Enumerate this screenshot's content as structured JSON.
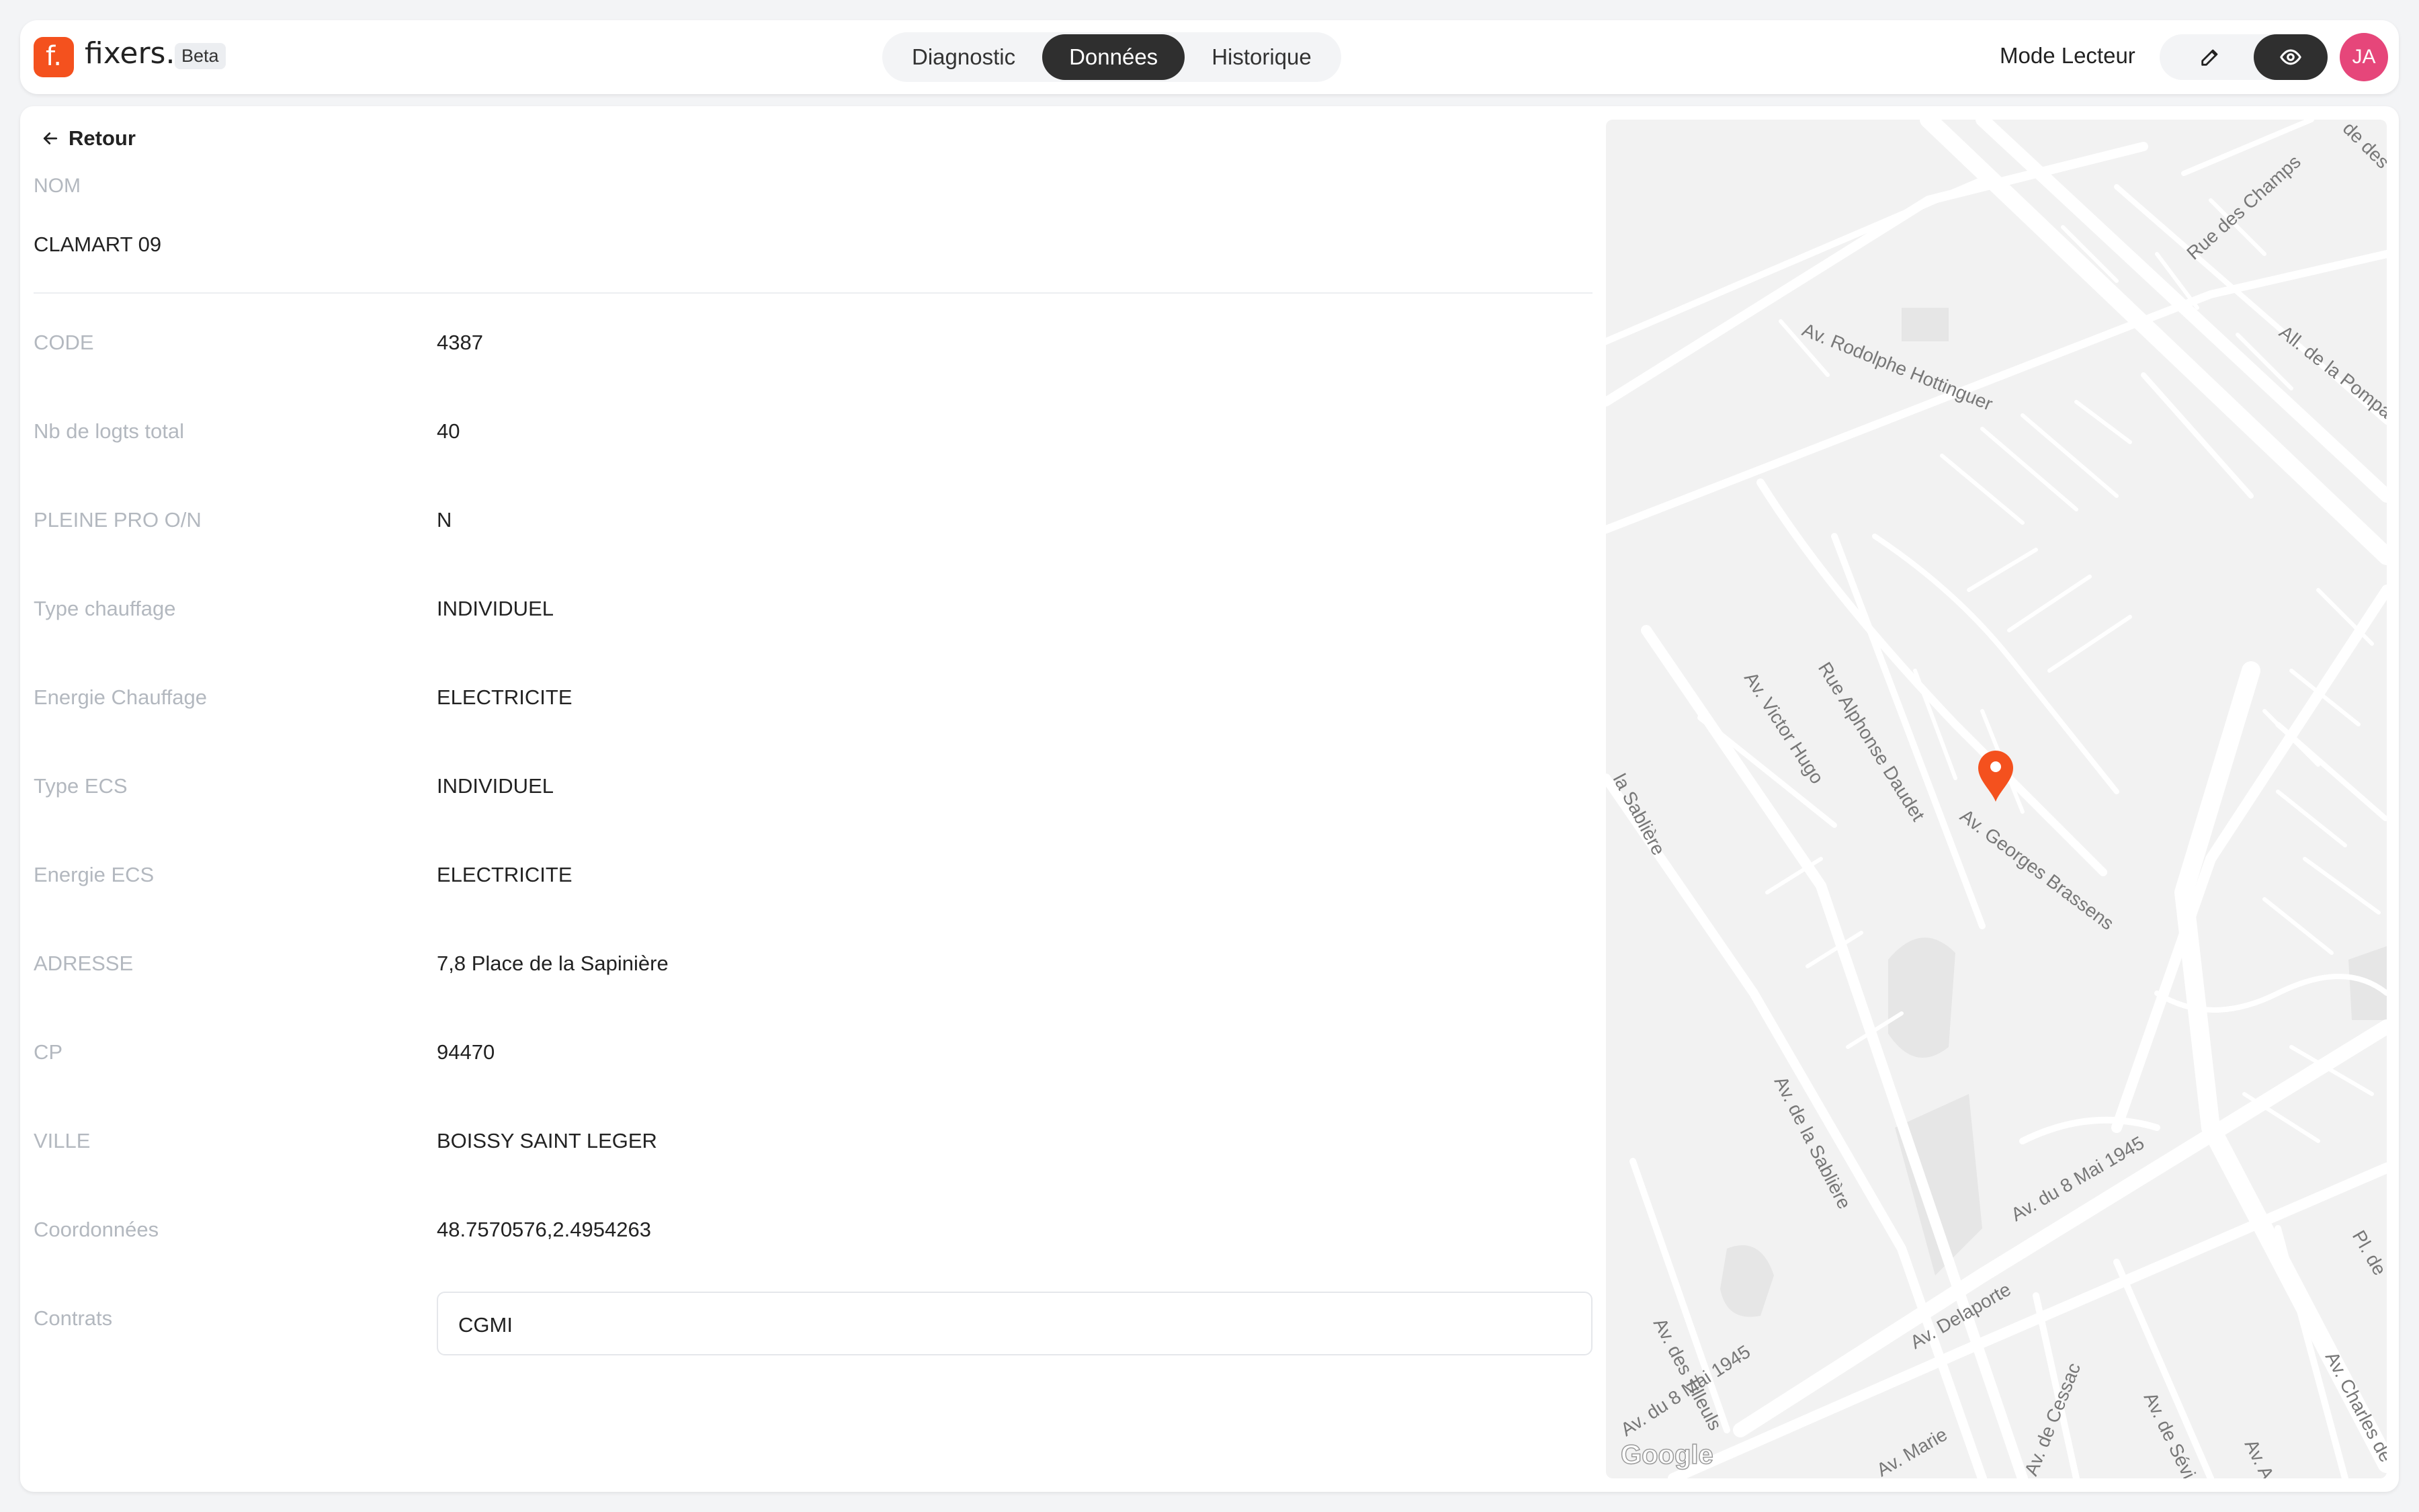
{
  "header": {
    "logo_letter": "f.",
    "logo_text": "fixers.",
    "beta_badge": "Beta",
    "tabs": [
      {
        "label": "Diagnostic",
        "active": false
      },
      {
        "label": "Données",
        "active": true
      },
      {
        "label": "Historique",
        "active": false
      }
    ],
    "mode_label": "Mode Lecteur",
    "avatar_initials": "JA"
  },
  "colors": {
    "brand": "#f4511e",
    "dark": "#2f2f2f",
    "avatar": "#e6467a",
    "muted_label": "#b3b8bf",
    "map_pin": "#f4511e"
  },
  "main": {
    "back_label": "Retour",
    "nom_label": "NOM",
    "nom_value": "CLAMART 09",
    "fields": [
      {
        "label": "CODE",
        "value": "4387"
      },
      {
        "label": "Nb de logts total",
        "value": "40"
      },
      {
        "label": "PLEINE PRO O/N",
        "value": "N"
      },
      {
        "label": "Type chauffage",
        "value": "INDIVIDUEL"
      },
      {
        "label": "Energie Chauffage",
        "value": "ELECTRICITE"
      },
      {
        "label": "Type ECS",
        "value": "INDIVIDUEL"
      },
      {
        "label": "Energie ECS",
        "value": "ELECTRICITE"
      },
      {
        "label": "ADRESSE",
        "value": "7,8 Place de la Sapinière"
      },
      {
        "label": "CP",
        "value": "94470"
      },
      {
        "label": "VILLE",
        "value": "BOISSY SAINT LEGER"
      },
      {
        "label": "Coordonnées",
        "value": "48.7570576,2.4954263"
      }
    ],
    "contrats_label": "Contrats",
    "contrats_value": "CGMI"
  },
  "map": {
    "streets": [
      "Rue des Champs",
      "Av. Rodolphe Hottinguer",
      "All. de la Pompado",
      "Rue Alphonse Daudet",
      "Av. Victor Hugo",
      "Av. Georges Brassens",
      "la Sablière",
      "Av. de la Sablière",
      "Av. du 8 Mai 1945",
      "Av. des Tilleuls",
      "Av. Delaporte",
      "Av. du 8 Mai 1945",
      "Av. Marie",
      "Av. de Cessac",
      "Av. de Sévi",
      "Av. A",
      "Av. Charles de",
      "Pl. de",
      "de des"
    ],
    "attribution": "Google"
  }
}
